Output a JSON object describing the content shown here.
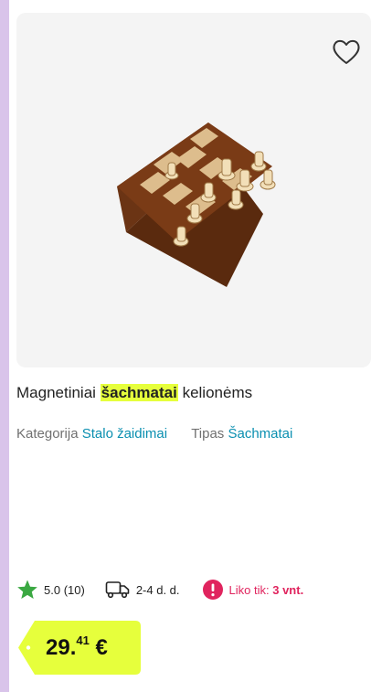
{
  "product": {
    "title_before": "Magnetiniai ",
    "title_highlight": "šachmatai",
    "title_after": " kelionėms",
    "category_label": "Kategorija",
    "category_value": "Stalo žaidimai",
    "type_label": "Tipas",
    "type_value": "Šachmatai",
    "rating": "5.0",
    "review_count": "(10)",
    "delivery": "2-4 d. d.",
    "stock_label": "Liko tik:",
    "stock_value": "3 vnt.",
    "price_main": "29.",
    "price_cents": "41",
    "currency": "€"
  },
  "icons": {
    "wishlist": "heart-outline-icon",
    "rating": "star-icon",
    "delivery": "truck-icon",
    "stock": "alert-icon"
  },
  "colors": {
    "highlight": "#e6ff3c",
    "link": "#0a8fb0",
    "star": "#3aa842",
    "alert": "#e0245e",
    "price_tag": "#e6ff3c"
  }
}
